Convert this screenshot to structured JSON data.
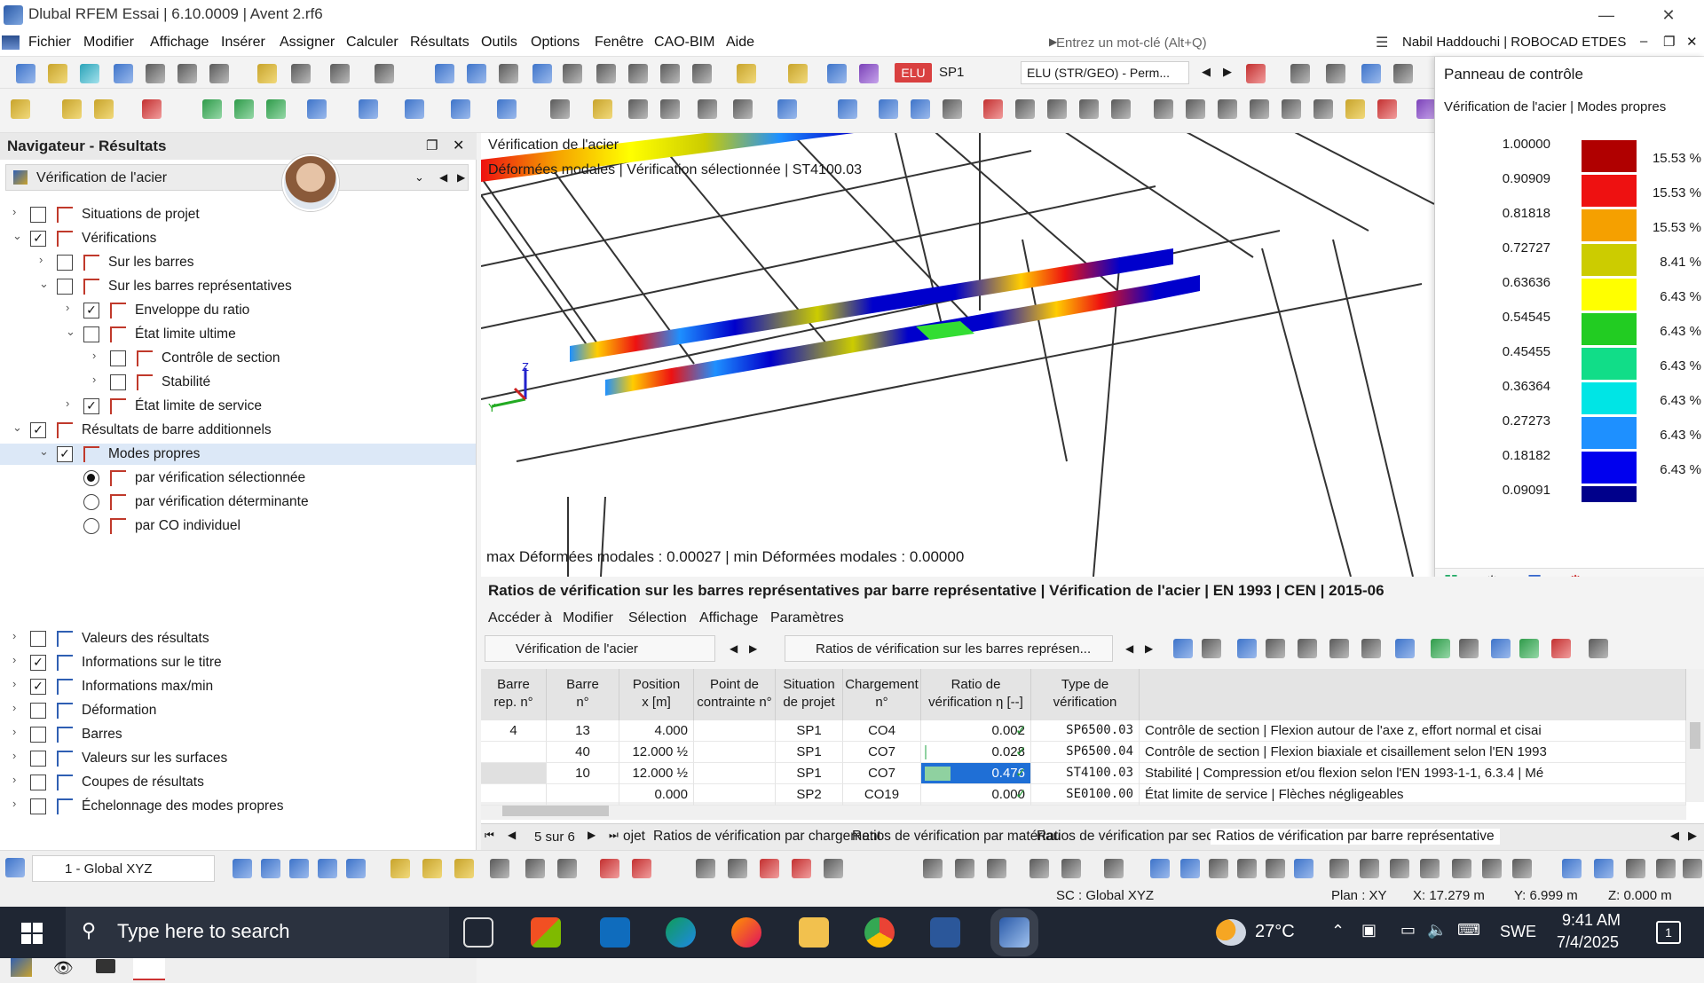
{
  "window": {
    "title": "Dlubal RFEM Essai | 6.10.0009 | Avent 2.rf6"
  },
  "menu": {
    "items": [
      "Fichier",
      "Modifier",
      "Affichage",
      "Insérer",
      "Assigner",
      "Calculer",
      "Résultats",
      "Outils",
      "Options",
      "Fenêtre",
      "CAO-BIM",
      "Aide"
    ],
    "search_placeholder": "Entrez un mot-clé (Alt+Q)",
    "user": "Nabil Haddouchi | ROBOCAD ETDES"
  },
  "toolbar": {
    "elu_badge": "ELU",
    "situation": "SP1",
    "combo": "ELU (STR/GEO) - Perm..."
  },
  "navigator": {
    "title": "Navigateur - Résultats",
    "combo": "Vérification de l'acier",
    "tree": [
      {
        "label": "Situations de projet",
        "level": 0,
        "chev": "›",
        "check": ""
      },
      {
        "label": "Vérifications",
        "level": 0,
        "chev": "⌄",
        "check": "✓"
      },
      {
        "label": "Sur les barres",
        "level": 1,
        "chev": "›",
        "check": ""
      },
      {
        "label": "Sur les barres représentatives",
        "level": 1,
        "chev": "⌄",
        "check": ""
      },
      {
        "label": "Enveloppe du ratio",
        "level": 2,
        "chev": "›",
        "check": "✓"
      },
      {
        "label": "État limite ultime",
        "level": 2,
        "chev": "⌄",
        "check": ""
      },
      {
        "label": "Contrôle de section",
        "level": 3,
        "chev": "›",
        "check": ""
      },
      {
        "label": "Stabilité",
        "level": 3,
        "chev": "›",
        "check": ""
      },
      {
        "label": "État limite de service",
        "level": 2,
        "chev": "›",
        "check": "✓"
      },
      {
        "label": "Résultats de barre additionnels",
        "level": 0,
        "chev": "⌄",
        "check": "✓"
      },
      {
        "label": "Modes propres",
        "level": 1,
        "chev": "⌄",
        "check": "✓"
      }
    ],
    "radios": [
      "par vérification sélectionnée",
      "par vérification déterminante",
      "par CO individuel"
    ],
    "lower": [
      {
        "label": "Valeurs des résultats",
        "check": ""
      },
      {
        "label": "Informations sur le titre",
        "check": "✓"
      },
      {
        "label": "Informations max/min",
        "check": "✓"
      },
      {
        "label": "Déformation",
        "check": ""
      },
      {
        "label": "Barres",
        "check": ""
      },
      {
        "label": "Valeurs sur les surfaces",
        "check": ""
      },
      {
        "label": "Coupes de résultats",
        "check": ""
      },
      {
        "label": "Échelonnage des modes propres",
        "check": ""
      }
    ]
  },
  "viewport": {
    "title1": "Vérification de l'acier",
    "title2": "Déformées modales | Vérification sélectionnée | ST4100.03",
    "max_min": "max Déformées modales : 0.00027 | min Déformées modales : 0.00000",
    "axis_z": "Z",
    "axis_y": "Y"
  },
  "control_panel": {
    "title": "Panneau de contrôle",
    "subtitle": "Vérification de l'acier | Modes propres",
    "legend": [
      {
        "value": "1.00000",
        "color": "#b00000",
        "pct": "15.53 %"
      },
      {
        "value": "0.90909",
        "color": "#ee1111",
        "pct": "15.53 %"
      },
      {
        "value": "0.81818",
        "color": "#f5a000",
        "pct": "15.53 %"
      },
      {
        "value": "0.72727",
        "color": "#cccc00",
        "pct": "8.41 %"
      },
      {
        "value": "0.63636",
        "color": "#ffff00",
        "pct": "6.43 %"
      },
      {
        "value": "0.54545",
        "color": "#22cc22",
        "pct": "6.43 %"
      },
      {
        "value": "0.45455",
        "color": "#11dd88",
        "pct": "6.43 %"
      },
      {
        "value": "0.36364",
        "color": "#00e5e5",
        "pct": "6.43 %"
      },
      {
        "value": "0.27273",
        "color": "#1e90ff",
        "pct": "6.43 %"
      },
      {
        "value": "0.18182",
        "color": "#0000ee",
        "pct": "6.43 %"
      },
      {
        "value": "0.09091",
        "color": "#00008b",
        "pct": ""
      }
    ]
  },
  "results": {
    "title": "Ratios de vérification sur les barres représentatives par barre représentative | Vérification de l'acier | EN 1993 | CEN | 2015-06",
    "menu": [
      "Accéder à",
      "Modifier",
      "Sélection",
      "Affichage",
      "Paramètres"
    ],
    "combo1": "Vérification de l'acier",
    "combo2": "Ratios de vérification sur les barres représen...",
    "headers": [
      "Barre\nrep. n°",
      "Barre\nn°",
      "Position\nx [m]",
      "Point de\ncontrainte n°",
      "Situation\nde projet",
      "Chargement\nn°",
      "Ratio de\nvérification η [--]",
      "Type de\nvérification",
      ""
    ],
    "rows": [
      {
        "rep": "4",
        "barre": "13",
        "pos": "4.000",
        "pt": "",
        "sit": "SP1",
        "ch": "CO4",
        "ratio": "0.002",
        "type": "SP6500.03",
        "desc": "Contrôle de section | Flexion autour de l'axe z, effort normal et cisai"
      },
      {
        "rep": "",
        "barre": "40",
        "pos": "12.000 ½",
        "pt": "",
        "sit": "SP1",
        "ch": "CO7",
        "ratio": "0.028",
        "type": "SP6500.04",
        "desc": "Contrôle de section | Flexion biaxiale et cisaillement selon l'EN 1993"
      },
      {
        "rep": "",
        "barre": "10",
        "pos": "12.000 ½",
        "pt": "",
        "sit": "SP1",
        "ch": "CO7",
        "ratio": "0.476",
        "type": "ST4100.03",
        "desc": "Stabilité | Compression et/ou flexion selon l'EN 1993-1-1, 6.3.4 | Mé"
      },
      {
        "rep": "",
        "barre": "",
        "pos": "0.000",
        "pt": "",
        "sit": "SP2",
        "ch": "CO19",
        "ratio": "0.000",
        "type": "SE0100.00",
        "desc": "État limite de service | Flèches négligeables"
      }
    ],
    "pager": "5 sur 6",
    "tabs": [
      "ojet",
      "Ratios de vérification par chargement",
      "Ratios de vérification par matériau",
      "Ratios de vérification par section",
      "Ratios de vérification par barre représentative"
    ]
  },
  "bottom": {
    "coord_combo": "1 - Global XYZ"
  },
  "status": {
    "sc": "SC : Global XYZ",
    "plan": "Plan : XY",
    "x": "X: 17.279 m",
    "y": "Y: 6.999 m",
    "z": "Z: 0.000 m"
  },
  "taskbar": {
    "search": "Type here to search",
    "temp": "27°C",
    "lang": "SWE",
    "time": "9:41 AM",
    "date": "7/4/2025",
    "notif": "1"
  }
}
